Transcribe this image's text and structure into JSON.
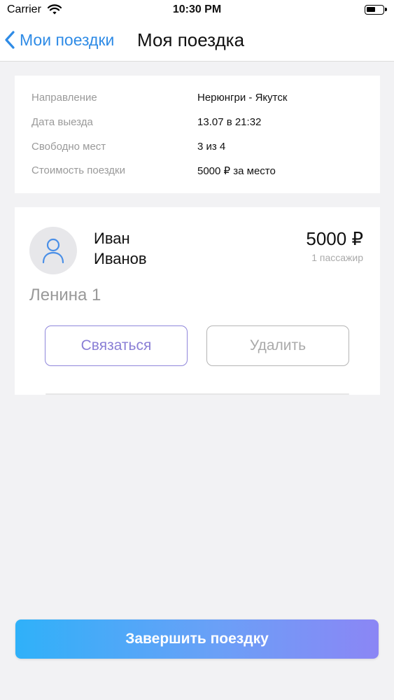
{
  "status_bar": {
    "carrier": "Carrier",
    "time": "10:30 PM",
    "icons": [
      "wifi-icon",
      "battery-icon"
    ]
  },
  "nav": {
    "back_label": "Мои поездки",
    "title": "Моя поездка",
    "back_icon": "chevron-left-icon",
    "accent_color": "#2e8be6"
  },
  "trip_info": {
    "rows": [
      {
        "label": "Направление",
        "value": "Нерюнгри - Якутск"
      },
      {
        "label": "Дата выезда",
        "value": "13.07 в 21:32"
      },
      {
        "label": "Свободно мест",
        "value": "3 из 4"
      },
      {
        "label": "Стоимость поездки",
        "value": "5000 ₽ за место"
      }
    ]
  },
  "passenger": {
    "first_name": "Иван",
    "last_name": "Иванов",
    "price": "5000 ₽",
    "count": "1 пассажир",
    "address": "Ленина 1",
    "avatar_icon": "user-icon",
    "contact_label": "Связаться",
    "delete_label": "Удалить",
    "contact_color": "#8a7fd6"
  },
  "footer": {
    "finish_label": "Завершить поездку",
    "gradient_start": "#2fb1f9",
    "gradient_end": "#8b86f5"
  }
}
